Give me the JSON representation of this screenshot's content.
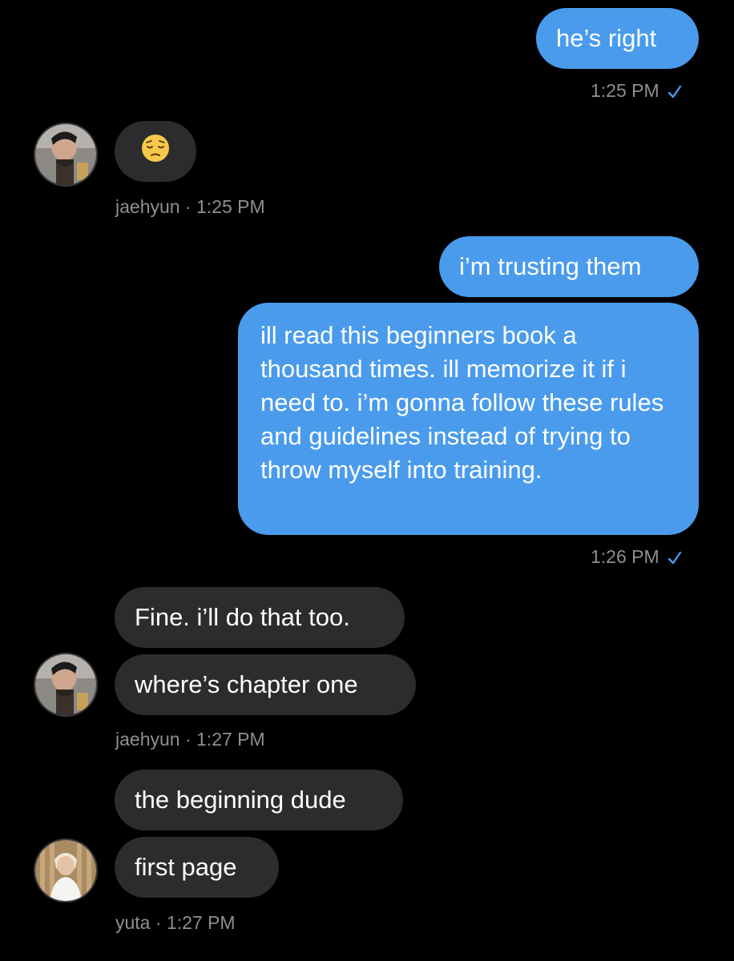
{
  "colors": {
    "background": "#000000",
    "outgoing_bubble": "#4a9bec",
    "incoming_bubble": "#2c2c2e",
    "meta_text": "#8e8e93",
    "read_check": "#4a9bec"
  },
  "messages": [
    {
      "sender": "me",
      "text": "he’s right"
    },
    {
      "sender": "me",
      "time": "1:25 PM",
      "status_icon": "check-icon"
    },
    {
      "sender": "jaehyun",
      "emoji_icon": "pensive-face-emoji"
    },
    {
      "sender": "jaehyun",
      "meta": "jaehyun · 1:25 PM"
    },
    {
      "sender": "me",
      "text": "i’m trusting them"
    },
    {
      "sender": "me",
      "text": "ill read this beginners book a thousand times. ill memorize it if i need to. i’m gonna follow these rules and guidelines instead of trying to throw myself into training."
    },
    {
      "sender": "me",
      "time": "1:26 PM",
      "status_icon": "check-icon"
    },
    {
      "sender": "jaehyun",
      "text": "Fine. i’ll do that too."
    },
    {
      "sender": "jaehyun",
      "text": "where’s chapter one"
    },
    {
      "sender": "jaehyun",
      "meta": "jaehyun · 1:27 PM"
    },
    {
      "sender": "yuta",
      "text": "the beginning dude"
    },
    {
      "sender": "yuta",
      "text": "first page"
    },
    {
      "sender": "yuta",
      "meta": "yuta · 1:27 PM"
    }
  ]
}
